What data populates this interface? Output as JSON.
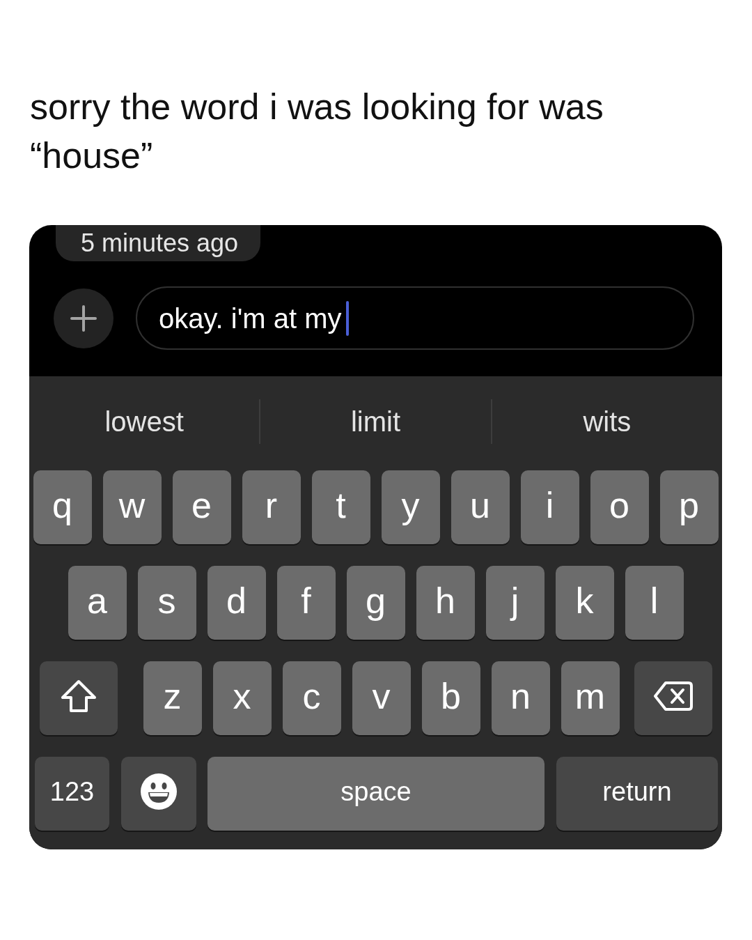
{
  "caption": "sorry the word i was looking for was “house”",
  "chat": {
    "bubble": {
      "text": "5 minutes ago"
    },
    "message_field": {
      "value": "okay. i'm at my",
      "focused": true
    }
  },
  "keyboard": {
    "suggestions": [
      "lowest",
      "limit",
      "wits"
    ],
    "rows": [
      {
        "keys": [
          {
            "kind": "letter",
            "label": "q"
          },
          {
            "kind": "letter",
            "label": "w"
          },
          {
            "kind": "letter",
            "label": "e"
          },
          {
            "kind": "letter",
            "label": "r"
          },
          {
            "kind": "letter",
            "label": "t"
          },
          {
            "kind": "letter",
            "label": "y"
          },
          {
            "kind": "letter",
            "label": "u"
          },
          {
            "kind": "letter",
            "label": "i"
          },
          {
            "kind": "letter",
            "label": "o"
          },
          {
            "kind": "letter",
            "label": "p"
          }
        ]
      },
      {
        "keys": [
          {
            "kind": "letter",
            "label": "a"
          },
          {
            "kind": "letter",
            "label": "s"
          },
          {
            "kind": "letter",
            "label": "d"
          },
          {
            "kind": "letter",
            "label": "f"
          },
          {
            "kind": "letter",
            "label": "g"
          },
          {
            "kind": "letter",
            "label": "h"
          },
          {
            "kind": "letter",
            "label": "j"
          },
          {
            "kind": "letter",
            "label": "k"
          },
          {
            "kind": "letter",
            "label": "l"
          }
        ]
      },
      {
        "keys": [
          {
            "kind": "shift"
          },
          {
            "kind": "letter",
            "label": "z"
          },
          {
            "kind": "letter",
            "label": "x"
          },
          {
            "kind": "letter",
            "label": "c"
          },
          {
            "kind": "letter",
            "label": "v"
          },
          {
            "kind": "letter",
            "label": "b"
          },
          {
            "kind": "letter",
            "label": "n"
          },
          {
            "kind": "letter",
            "label": "m"
          },
          {
            "kind": "backspace"
          }
        ]
      },
      {
        "keys": [
          {
            "kind": "numbers",
            "label": "123"
          },
          {
            "kind": "emoji"
          },
          {
            "kind": "space",
            "label": "space"
          },
          {
            "kind": "return",
            "label": "return"
          }
        ]
      }
    ]
  }
}
